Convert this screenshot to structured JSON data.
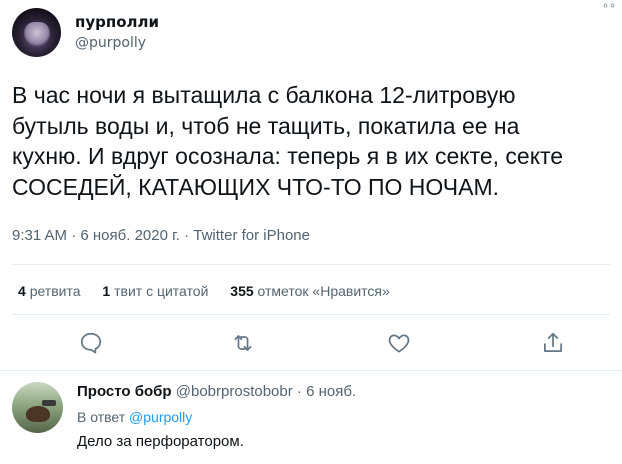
{
  "tweet": {
    "author_name": "пурполли",
    "author_handle": "@purpolly",
    "text_lines": [
      "В час ночи я вытащила с балкона 12-литровую",
      "бутыль воды и, чтоб не тащить, покатила ее на",
      "кухню. И вдруг осознала: теперь я в их секте, секте",
      "СОСЕДЕЙ, КАТАЮЩИХ ЧТО-ТО ПО НОЧАМ."
    ],
    "time": "9:31 AM",
    "date": "6 нояб. 2020 г.",
    "separator": "·",
    "source": "Twitter for iPhone",
    "more_icon": "more-dots-icon",
    "stats": {
      "retweets_count": "4",
      "retweets_label": "ретвита",
      "quotes_count": "1",
      "quotes_label": "твит с цитатой",
      "likes_count": "355",
      "likes_label": "отметок «Нравится»"
    },
    "actions": [
      "reply-icon",
      "retweet-icon",
      "like-icon",
      "share-icon"
    ]
  },
  "reply": {
    "author_name": "Просто бобр",
    "author_handle": "@bobrprostobobr",
    "separator": "·",
    "date": "6 нояб.",
    "reply_prefix": "В ответ",
    "reply_to": "@purpolly",
    "text": "Дело за перфоратором."
  },
  "colors": {
    "text": "#0f1419",
    "secondary": "#536471",
    "link": "#1d9bf0",
    "divider": "#e6ecf0"
  }
}
